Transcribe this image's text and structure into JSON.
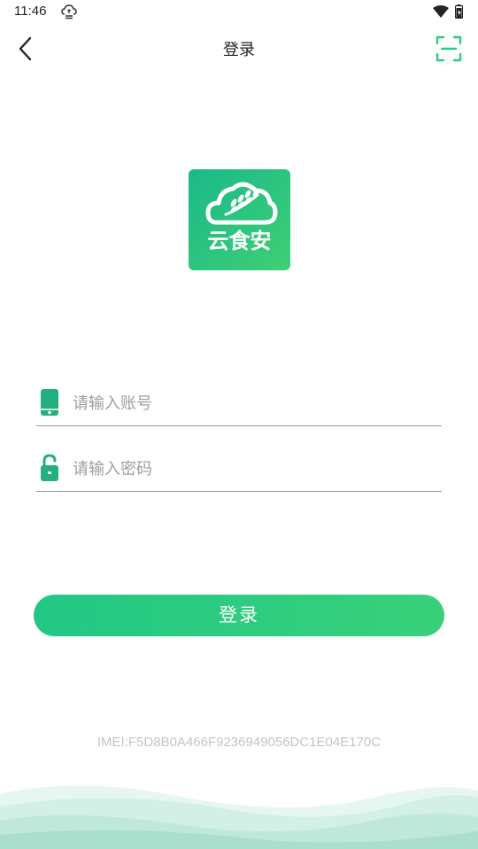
{
  "status_bar": {
    "time": "11:46",
    "notification_icon": "cloud-sync-icon",
    "wifi_icon": "wifi-icon",
    "battery_icon": "battery-icon"
  },
  "nav": {
    "back_icon": "chevron-left-icon",
    "title": "登录",
    "scan_icon": "scan-icon"
  },
  "logo": {
    "text": "云食安",
    "icon": "cloud-wheat-icon"
  },
  "form": {
    "account": {
      "icon": "phone-icon",
      "placeholder": "请输入账号",
      "value": ""
    },
    "password": {
      "icon": "lock-icon",
      "placeholder": "请输入密码",
      "value": ""
    },
    "login_label": "登录"
  },
  "imei": "IMEI:F5D8B0A466F9236949056DC1E04E170C",
  "colors": {
    "accent": "#2ecc80",
    "accent_dark": "#19b98a",
    "divider": "#9a9a9a",
    "placeholder": "#9e9e9e"
  }
}
